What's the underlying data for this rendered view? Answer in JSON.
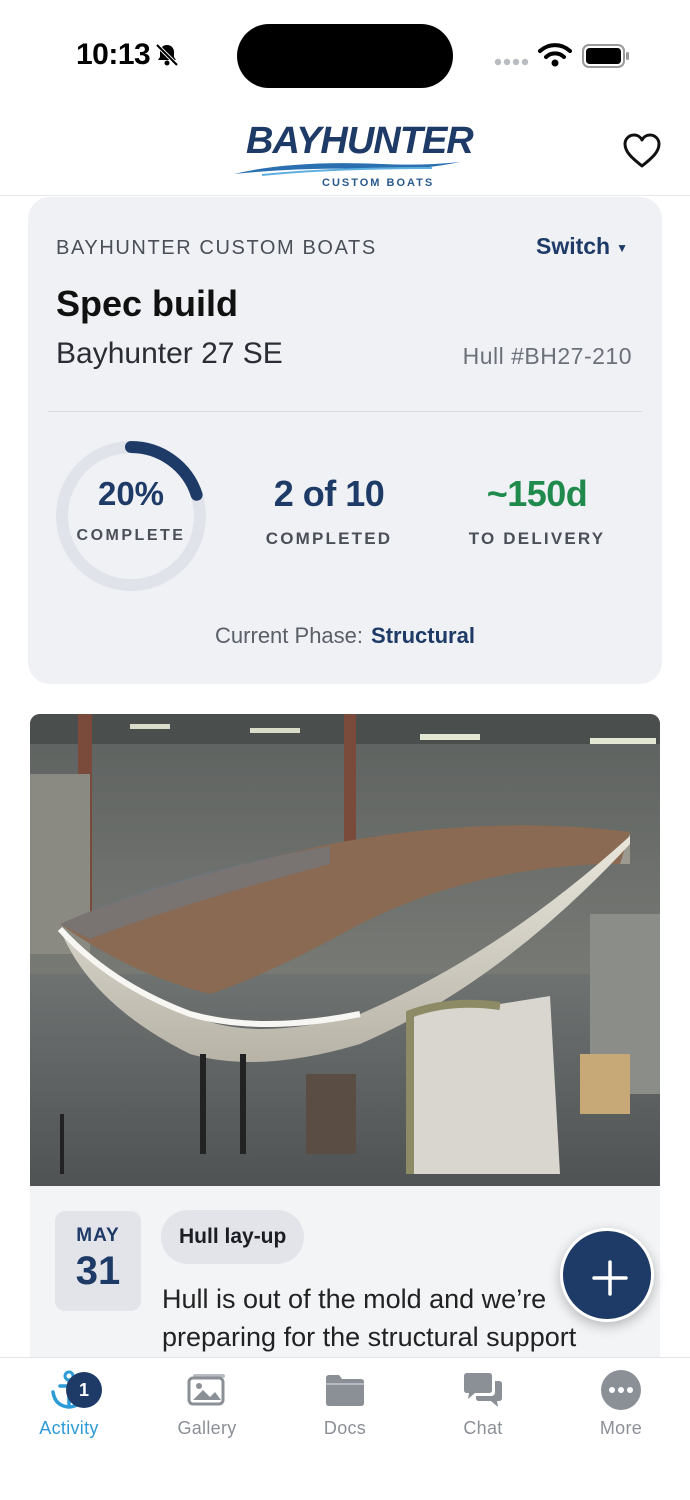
{
  "status_bar": {
    "time": "10:13",
    "icons": [
      "bell-slash-icon",
      "signal-icon",
      "wifi-icon",
      "battery-icon"
    ]
  },
  "header": {
    "logo_text": "BAYHUNTER",
    "logo_subtext": "CUSTOM BOATS",
    "favorite_icon": "heart-icon"
  },
  "summary": {
    "builder": "BAYHUNTER CUSTOM BOATS",
    "switch_label": "Switch",
    "build_title": "Spec build",
    "model": "Bayhunter 27 SE",
    "hull": "Hull #BH27-210",
    "progress_fraction": 0.2,
    "progress_pct": "20%",
    "progress_label": "COMPLETE",
    "completed_value": "2 of 10",
    "completed_label": "COMPLETED",
    "delivery_value": "~150d",
    "delivery_label": "TO DELIVERY",
    "phase_label": "Current Phase:",
    "phase_value": "Structural"
  },
  "post": {
    "photo_alt": "boat-hull-in-shop-photo",
    "date_month": "MAY",
    "date_day": "31",
    "tag": "Hull lay-up",
    "text": "Hull is out of the mold and we’re preparing for the structural support"
  },
  "fab": {
    "icon": "plus-icon"
  },
  "tabs": [
    {
      "label": "Activity",
      "icon": "anchor-icon",
      "active": true,
      "badge": "1"
    },
    {
      "label": "Gallery",
      "icon": "gallery-icon",
      "active": false
    },
    {
      "label": "Docs",
      "icon": "folder-icon",
      "active": false
    },
    {
      "label": "Chat",
      "icon": "chat-icon",
      "active": false
    },
    {
      "label": "More",
      "icon": "more-icon",
      "active": false
    }
  ],
  "colors": {
    "navy": "#1e3a66",
    "green": "#1f8a4c",
    "active_tab": "#2c9bd6",
    "card_bg": "#eff1f5"
  }
}
